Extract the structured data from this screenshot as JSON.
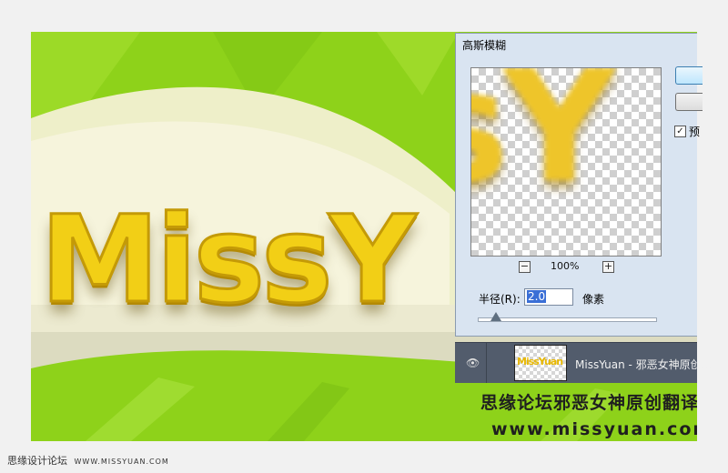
{
  "artwork": {
    "title_text": "MissY",
    "watermark_cn": "思缘论坛邪恶女神原创翻译",
    "watermark_url": "www.missyuan.com",
    "colors": {
      "leaf_green": "#8ed21a",
      "cream": "#f3f1d8",
      "text_yellow": "#f2cf16"
    }
  },
  "dialog": {
    "title": "高斯模糊",
    "preview_text": "sY",
    "zoom_level": "100%",
    "zoom_out_symbol": "−",
    "zoom_in_symbol": "+",
    "radius_label": "半径(R):",
    "radius_value": "2.0",
    "radius_unit": "像素",
    "radius_slider_fraction": 0.1,
    "preview_checkbox_checked": true,
    "preview_check_symbol": "✓",
    "preview_checkbox_label": "预"
  },
  "layers": {
    "eye_symbol": "👁",
    "thumb_text": "MissYuan",
    "layer_name": "MissYuan - 邪恶女神原创..."
  },
  "footer": {
    "credit_cn": "思缘设计论坛",
    "credit_site": "WWW.MISSYUAN.COM"
  }
}
